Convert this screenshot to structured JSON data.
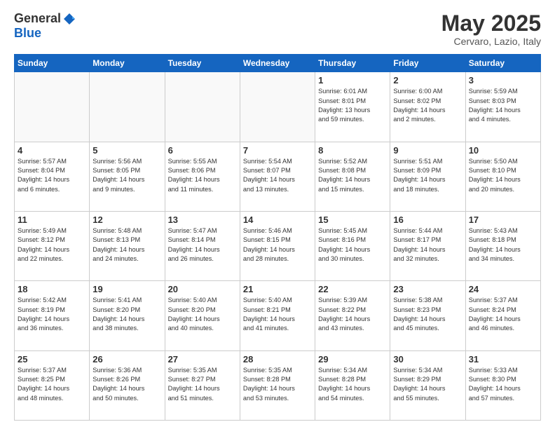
{
  "header": {
    "logo_general": "General",
    "logo_blue": "Blue",
    "month": "May 2025",
    "location": "Cervaro, Lazio, Italy"
  },
  "days_of_week": [
    "Sunday",
    "Monday",
    "Tuesday",
    "Wednesday",
    "Thursday",
    "Friday",
    "Saturday"
  ],
  "weeks": [
    [
      {
        "day": "",
        "info": ""
      },
      {
        "day": "",
        "info": ""
      },
      {
        "day": "",
        "info": ""
      },
      {
        "day": "",
        "info": ""
      },
      {
        "day": "1",
        "info": "Sunrise: 6:01 AM\nSunset: 8:01 PM\nDaylight: 13 hours\nand 59 minutes."
      },
      {
        "day": "2",
        "info": "Sunrise: 6:00 AM\nSunset: 8:02 PM\nDaylight: 14 hours\nand 2 minutes."
      },
      {
        "day": "3",
        "info": "Sunrise: 5:59 AM\nSunset: 8:03 PM\nDaylight: 14 hours\nand 4 minutes."
      }
    ],
    [
      {
        "day": "4",
        "info": "Sunrise: 5:57 AM\nSunset: 8:04 PM\nDaylight: 14 hours\nand 6 minutes."
      },
      {
        "day": "5",
        "info": "Sunrise: 5:56 AM\nSunset: 8:05 PM\nDaylight: 14 hours\nand 9 minutes."
      },
      {
        "day": "6",
        "info": "Sunrise: 5:55 AM\nSunset: 8:06 PM\nDaylight: 14 hours\nand 11 minutes."
      },
      {
        "day": "7",
        "info": "Sunrise: 5:54 AM\nSunset: 8:07 PM\nDaylight: 14 hours\nand 13 minutes."
      },
      {
        "day": "8",
        "info": "Sunrise: 5:52 AM\nSunset: 8:08 PM\nDaylight: 14 hours\nand 15 minutes."
      },
      {
        "day": "9",
        "info": "Sunrise: 5:51 AM\nSunset: 8:09 PM\nDaylight: 14 hours\nand 18 minutes."
      },
      {
        "day": "10",
        "info": "Sunrise: 5:50 AM\nSunset: 8:10 PM\nDaylight: 14 hours\nand 20 minutes."
      }
    ],
    [
      {
        "day": "11",
        "info": "Sunrise: 5:49 AM\nSunset: 8:12 PM\nDaylight: 14 hours\nand 22 minutes."
      },
      {
        "day": "12",
        "info": "Sunrise: 5:48 AM\nSunset: 8:13 PM\nDaylight: 14 hours\nand 24 minutes."
      },
      {
        "day": "13",
        "info": "Sunrise: 5:47 AM\nSunset: 8:14 PM\nDaylight: 14 hours\nand 26 minutes."
      },
      {
        "day": "14",
        "info": "Sunrise: 5:46 AM\nSunset: 8:15 PM\nDaylight: 14 hours\nand 28 minutes."
      },
      {
        "day": "15",
        "info": "Sunrise: 5:45 AM\nSunset: 8:16 PM\nDaylight: 14 hours\nand 30 minutes."
      },
      {
        "day": "16",
        "info": "Sunrise: 5:44 AM\nSunset: 8:17 PM\nDaylight: 14 hours\nand 32 minutes."
      },
      {
        "day": "17",
        "info": "Sunrise: 5:43 AM\nSunset: 8:18 PM\nDaylight: 14 hours\nand 34 minutes."
      }
    ],
    [
      {
        "day": "18",
        "info": "Sunrise: 5:42 AM\nSunset: 8:19 PM\nDaylight: 14 hours\nand 36 minutes."
      },
      {
        "day": "19",
        "info": "Sunrise: 5:41 AM\nSunset: 8:20 PM\nDaylight: 14 hours\nand 38 minutes."
      },
      {
        "day": "20",
        "info": "Sunrise: 5:40 AM\nSunset: 8:20 PM\nDaylight: 14 hours\nand 40 minutes."
      },
      {
        "day": "21",
        "info": "Sunrise: 5:40 AM\nSunset: 8:21 PM\nDaylight: 14 hours\nand 41 minutes."
      },
      {
        "day": "22",
        "info": "Sunrise: 5:39 AM\nSunset: 8:22 PM\nDaylight: 14 hours\nand 43 minutes."
      },
      {
        "day": "23",
        "info": "Sunrise: 5:38 AM\nSunset: 8:23 PM\nDaylight: 14 hours\nand 45 minutes."
      },
      {
        "day": "24",
        "info": "Sunrise: 5:37 AM\nSunset: 8:24 PM\nDaylight: 14 hours\nand 46 minutes."
      }
    ],
    [
      {
        "day": "25",
        "info": "Sunrise: 5:37 AM\nSunset: 8:25 PM\nDaylight: 14 hours\nand 48 minutes."
      },
      {
        "day": "26",
        "info": "Sunrise: 5:36 AM\nSunset: 8:26 PM\nDaylight: 14 hours\nand 50 minutes."
      },
      {
        "day": "27",
        "info": "Sunrise: 5:35 AM\nSunset: 8:27 PM\nDaylight: 14 hours\nand 51 minutes."
      },
      {
        "day": "28",
        "info": "Sunrise: 5:35 AM\nSunset: 8:28 PM\nDaylight: 14 hours\nand 53 minutes."
      },
      {
        "day": "29",
        "info": "Sunrise: 5:34 AM\nSunset: 8:28 PM\nDaylight: 14 hours\nand 54 minutes."
      },
      {
        "day": "30",
        "info": "Sunrise: 5:34 AM\nSunset: 8:29 PM\nDaylight: 14 hours\nand 55 minutes."
      },
      {
        "day": "31",
        "info": "Sunrise: 5:33 AM\nSunset: 8:30 PM\nDaylight: 14 hours\nand 57 minutes."
      }
    ]
  ]
}
